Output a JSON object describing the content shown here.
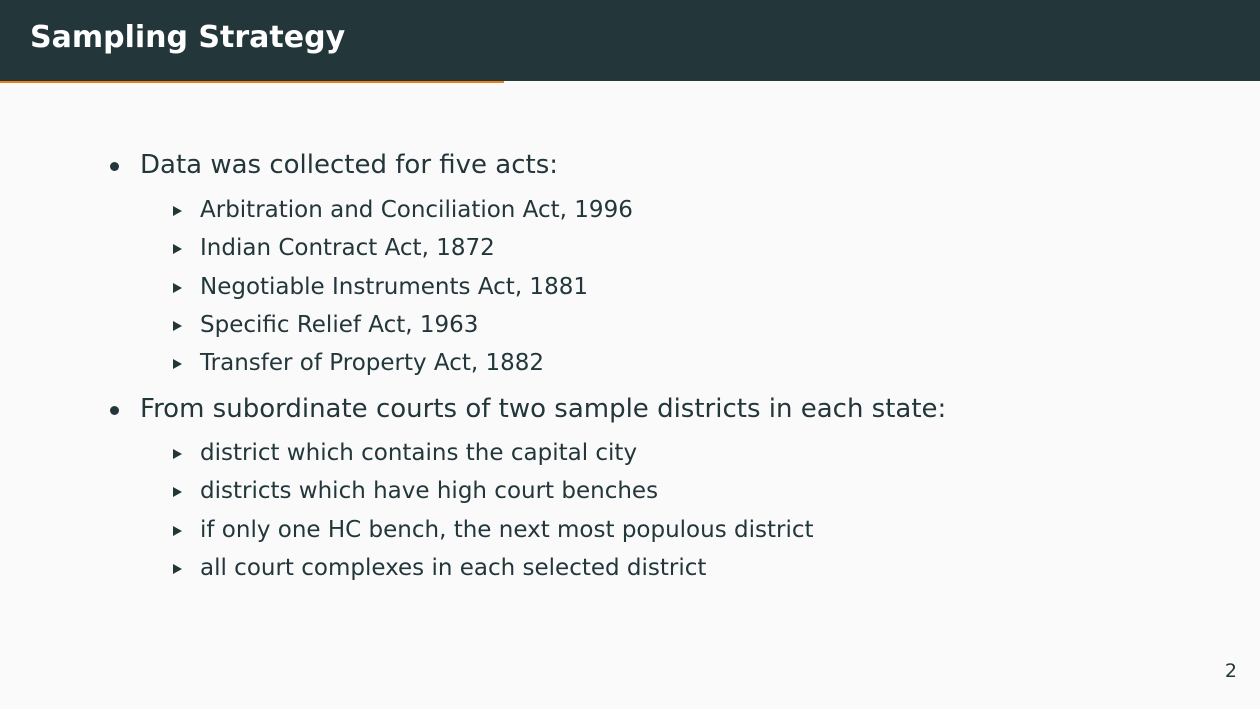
{
  "slide": {
    "title": "Sampling Strategy",
    "progress": 0.4,
    "page_number": "2",
    "colors": {
      "header": "#23373b",
      "background": "#fafafa",
      "text": "#23373b",
      "progress": "#eb811b"
    },
    "bullets": [
      {
        "text": "Data was collected for five acts:",
        "sub": [
          "Arbitration and Conciliation Act, 1996",
          "Indian Contract Act, 1872",
          "Negotiable Instruments Act, 1881",
          "Specific Relief Act, 1963",
          "Transfer of Property Act, 1882"
        ]
      },
      {
        "text": "From subordinate courts of two sample districts in each state:",
        "sub": [
          "district which contains the capital city",
          "districts which have high court benches",
          "if only one HC bench, the next most populous district",
          "all court complexes in each selected district"
        ]
      }
    ]
  }
}
